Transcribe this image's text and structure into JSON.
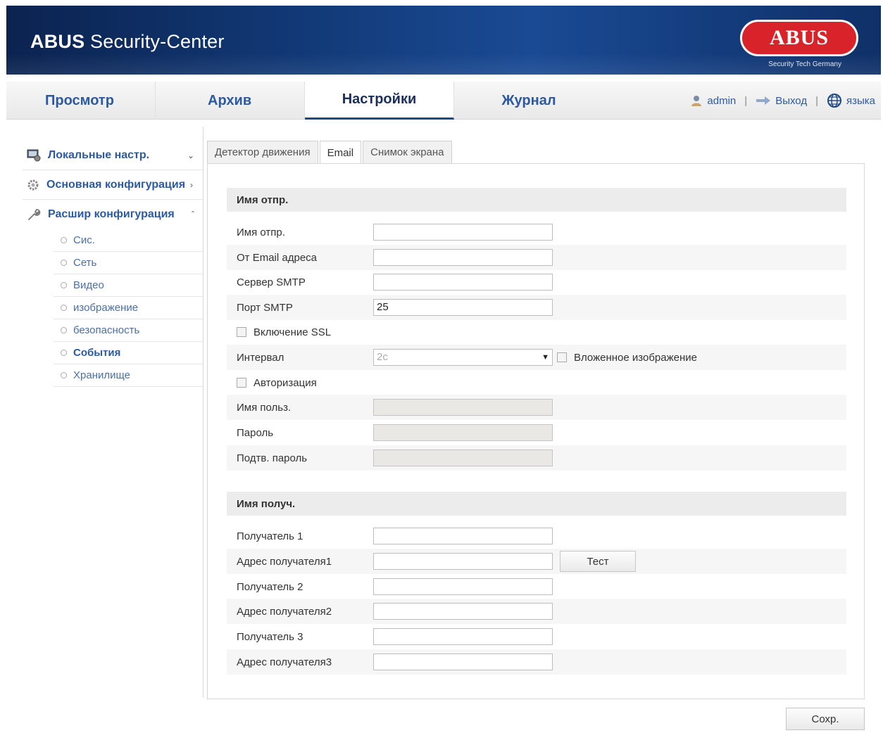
{
  "header": {
    "title_bold": "ABUS",
    "title_rest": " Security-Center",
    "logo_text": "ABUS",
    "logo_tagline": "Security Tech Germany"
  },
  "nav": {
    "tabs": [
      {
        "label": "Просмотр"
      },
      {
        "label": "Архив"
      },
      {
        "label": "Настройки",
        "active": true
      },
      {
        "label": "Журнал"
      }
    ],
    "user": "admin",
    "logout": "Выход",
    "language": "языка"
  },
  "sidebar": {
    "items": [
      {
        "label": "Локальные настр."
      },
      {
        "label": "Основная конфигурация"
      },
      {
        "label": "Расшир конфигурация"
      }
    ],
    "sub_items": [
      {
        "label": "Сис."
      },
      {
        "label": "Сеть"
      },
      {
        "label": "Видео"
      },
      {
        "label": "изображение"
      },
      {
        "label": "безопасность"
      },
      {
        "label": "События",
        "active": true
      },
      {
        "label": "Хранилище"
      }
    ]
  },
  "subtabs": [
    {
      "label": "Детектор движения"
    },
    {
      "label": "Email",
      "active": true
    },
    {
      "label": "Снимок экрана"
    }
  ],
  "sender": {
    "heading": "Имя отпр.",
    "name_label": "Имя отпр.",
    "name_value": "",
    "from_label": "От Email адреса",
    "from_value": "",
    "smtp_server_label": "Сервер SMTP",
    "smtp_server_value": "",
    "smtp_port_label": "Порт SMTP",
    "smtp_port_value": "25",
    "ssl_label": "Включение SSL",
    "interval_label": "Интервал",
    "interval_value": "2с",
    "attach_label": "Вложенное изображение",
    "auth_label": "Авторизация",
    "user_label": "Имя польз.",
    "password_label": "Пароль",
    "confirm_label": "Подтв. пароль"
  },
  "recipients": {
    "heading": "Имя получ.",
    "r1_name_label": "Получатель 1",
    "r1_addr_label": "Адрес получателя1",
    "test_label": "Тест",
    "r2_name_label": "Получатель 2",
    "r2_addr_label": "Адрес получателя2",
    "r3_name_label": "Получатель 3",
    "r3_addr_label": "Адрес получателя3"
  },
  "save_label": "Сохр.",
  "colors": {
    "header_bg": "#123a78",
    "link_blue": "#2b5aa3",
    "logo_red": "#d8232a"
  }
}
